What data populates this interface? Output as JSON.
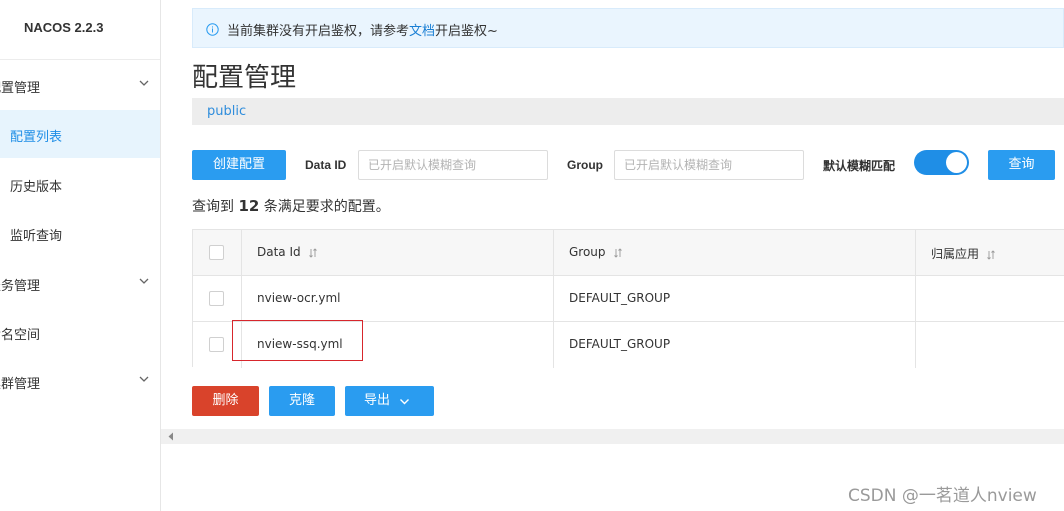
{
  "sidebar": {
    "brand": "NACOS 2.2.3",
    "items": [
      {
        "label": "配置管理",
        "expandable": true
      },
      {
        "label": "配置列表",
        "active": true
      },
      {
        "label": "历史版本"
      },
      {
        "label": "监听查询"
      },
      {
        "label": "服务管理",
        "expandable": true
      },
      {
        "label": "命名空间"
      },
      {
        "label": "集群管理",
        "expandable": true
      }
    ]
  },
  "notice": {
    "prefix": "当前集群没有开启鉴权，请参考",
    "link": "文档",
    "suffix": "开启鉴权~"
  },
  "page": {
    "title": "配置管理",
    "namespace": "public"
  },
  "toolbar": {
    "create_label": "创建配置",
    "data_id_label": "Data ID",
    "data_id_placeholder": "已开启默认模糊查询",
    "data_id_value": "",
    "group_label": "Group",
    "group_placeholder": "已开启默认模糊查询",
    "group_value": "",
    "fuzzy_label": "默认模糊匹配",
    "fuzzy_enabled": true,
    "query_label": "查询"
  },
  "result": {
    "prefix": "查询到",
    "count": "12",
    "suffix": "条满足要求的配置。"
  },
  "table": {
    "headers": [
      "Data Id",
      "Group",
      "归属应用"
    ],
    "rows": [
      {
        "data_id": "nview-ocr.yml",
        "group": "DEFAULT_GROUP",
        "app": ""
      },
      {
        "data_id": "nview-ssq.yml",
        "group": "DEFAULT_GROUP",
        "app": ""
      }
    ]
  },
  "actions": {
    "delete_label": "删除",
    "clone_label": "克隆",
    "export_label": "导出"
  },
  "watermark": "CSDN @一茗道人nview",
  "colors": {
    "primary": "#2a9cf0",
    "danger": "#d9432b",
    "highlight": "#d7262c"
  }
}
